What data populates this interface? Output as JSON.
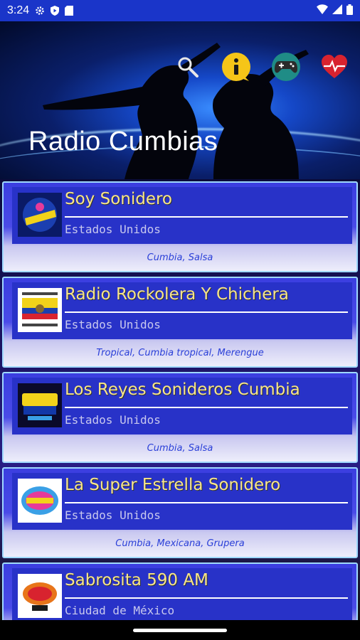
{
  "status_bar": {
    "time": "3:24",
    "icons": [
      "gear-icon",
      "shield-play-icon",
      "sim-card-icon"
    ],
    "right_icons": [
      "wifi-icon",
      "signal-icon",
      "battery-icon"
    ]
  },
  "header": {
    "title": "Radio Cumbias",
    "actions": [
      "search-icon",
      "info-icon",
      "gamepad-icon",
      "heart-pulse-icon"
    ]
  },
  "stations": [
    {
      "name": "Soy Sonidero",
      "country": "Estados Unidos",
      "genre": "Cumbia, Salsa",
      "logo_color": "#1b3fb0"
    },
    {
      "name": "Radio Rockolera Y Chichera",
      "country": "Estados Unidos",
      "genre": "Tropical, Cumbia tropical, Merengue",
      "logo_color": "#f2d21a"
    },
    {
      "name": "Los Reyes Sonideros Cumbia",
      "country": "Estados Unidos",
      "genre": "Cumbia,  Salsa",
      "logo_color": "#1238a8"
    },
    {
      "name": "La Super Estrella Sonidero",
      "country": "Estados Unidos",
      "genre": "Cumbia, Mexicana, Grupera",
      "logo_color": "#3aa0e6"
    },
    {
      "name": "Sabrosita 590 AM",
      "country": "Ciudad de México",
      "genre": "",
      "logo_color": "#e8751a"
    }
  ],
  "colors": {
    "status_bar": "#1a35c9",
    "station_name": "#f7e58a",
    "genre": "#2a3fd8"
  }
}
